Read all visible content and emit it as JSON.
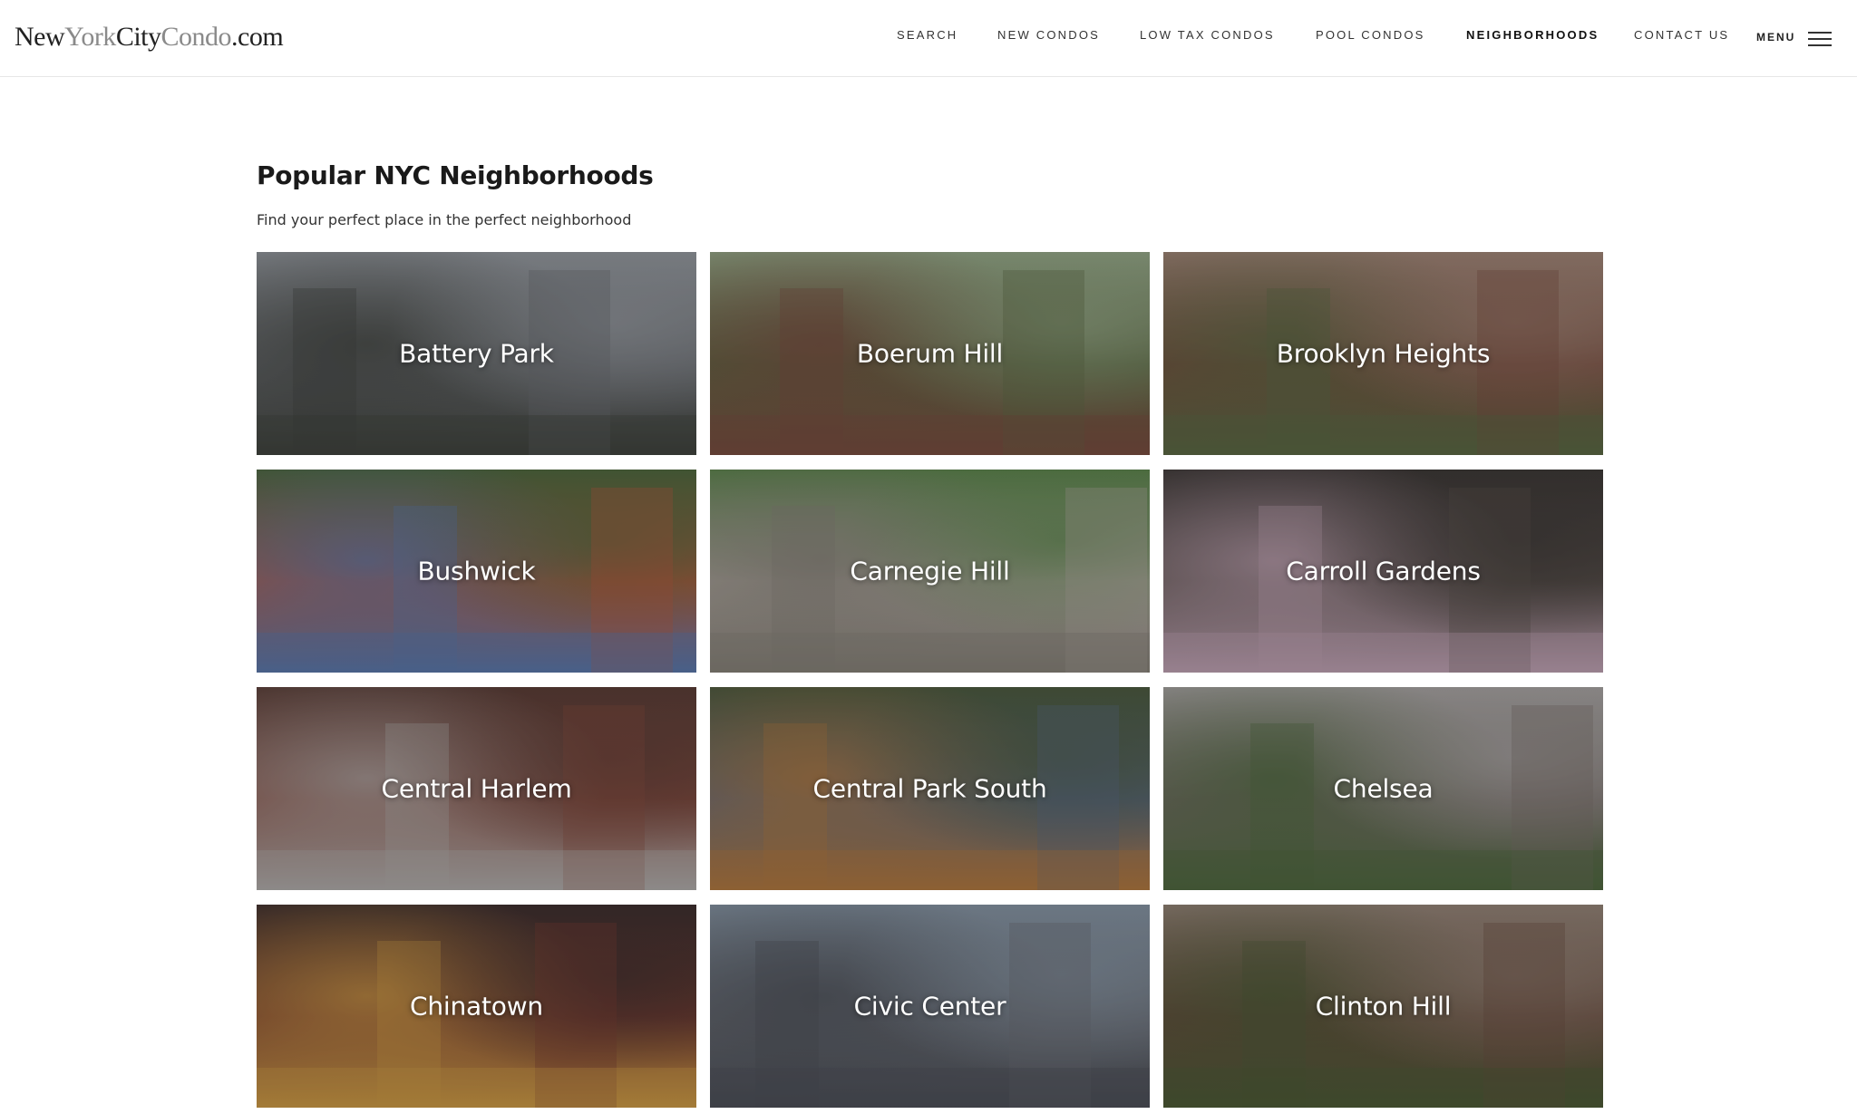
{
  "header": {
    "logo": {
      "part1": "New",
      "part2": "York",
      "part3": "City",
      "part4": "Condo",
      "part5": ".com"
    },
    "nav": [
      {
        "label": "SEARCH",
        "active": false
      },
      {
        "label": "NEW CONDOS",
        "active": false
      },
      {
        "label": "LOW TAX CONDOS",
        "active": false
      },
      {
        "label": "POOL CONDOS",
        "active": false
      },
      {
        "label": "NEIGHBORHOODS",
        "active": true
      },
      {
        "label": "CONTACT US",
        "active": false
      }
    ],
    "menu_label": "MENU"
  },
  "main": {
    "title": "Popular NYC Neighborhoods",
    "subtitle": "Find your perfect place in the perfect neighborhood",
    "neighborhoods": [
      {
        "name": "Battery Park",
        "palette": [
          "#6b6e70",
          "#3d4038",
          "#9a9fa3"
        ]
      },
      {
        "name": "Boerum Hill",
        "palette": [
          "#5d6a3e",
          "#7a4a3a",
          "#9bb08a"
        ]
      },
      {
        "name": "Brooklyn Heights",
        "palette": [
          "#7a4a38",
          "#5a6a3e",
          "#a88a78"
        ]
      },
      {
        "name": "Bushwick",
        "palette": [
          "#c05a3a",
          "#5a7ab0",
          "#4e6a3a"
        ]
      },
      {
        "name": "Carnegie Hill",
        "palette": [
          "#b8b0a4",
          "#8a8478",
          "#5e8a4a"
        ]
      },
      {
        "name": "Carroll Gardens",
        "palette": [
          "#5a5048",
          "#c8a8b8",
          "#3a3530"
        ]
      },
      {
        "name": "Central Harlem",
        "palette": [
          "#8a4a3a",
          "#b8b4b0",
          "#5a3a30"
        ]
      },
      {
        "name": "Central Park South",
        "palette": [
          "#5a6a80",
          "#b87a3a",
          "#4a5a3a"
        ]
      },
      {
        "name": "Chelsea",
        "palette": [
          "#7a7068",
          "#4e6a3a",
          "#b0aca8"
        ]
      },
      {
        "name": "Chinatown",
        "palette": [
          "#7a3a2a",
          "#d8a040",
          "#3a2a28"
        ]
      },
      {
        "name": "Civic Center",
        "palette": [
          "#6a6e74",
          "#4a4e54",
          "#8a9aa8"
        ]
      },
      {
        "name": "Clinton Hill",
        "palette": [
          "#6a4a38",
          "#4a5a30",
          "#9a8878"
        ]
      }
    ]
  }
}
